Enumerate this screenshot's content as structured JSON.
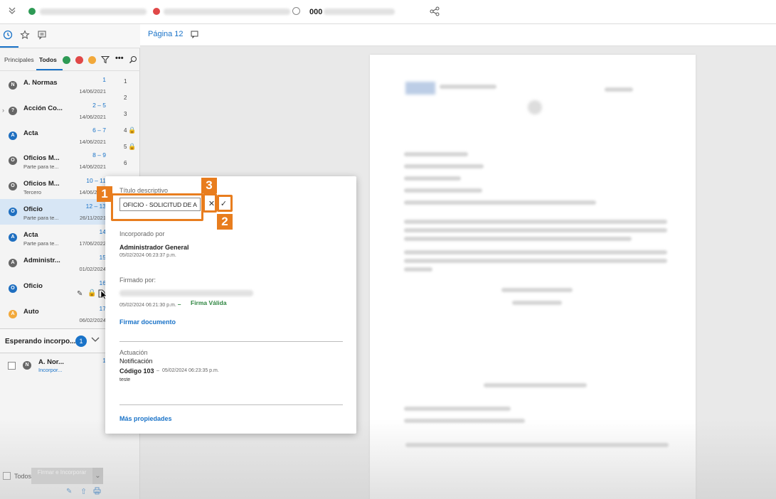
{
  "topbar": {
    "doc_number": "000",
    "icons": [
      "collapse-chevron-icon",
      "add-icon",
      "remove-icon",
      "info-icon",
      "share-icon"
    ]
  },
  "left_panel": {
    "icon_tabs": [
      "clock-icon",
      "star-icon",
      "comment-icon"
    ],
    "filter_tabs": [
      "Principales",
      "Todos"
    ],
    "documents": [
      {
        "title": "A. Normas",
        "subtitle": "",
        "pages": "1",
        "date": "14/06/2021",
        "icon": "N",
        "color": "gray"
      },
      {
        "title": "Acción Co...",
        "subtitle": "",
        "pages": "2 – 5",
        "date": "14/06/2021",
        "icon": "?",
        "color": "gray",
        "expandable": true
      },
      {
        "title": "Acta",
        "subtitle": "",
        "pages": "6 – 7",
        "date": "14/06/2021",
        "icon": "A",
        "color": "blue"
      },
      {
        "title": "Oficios M...",
        "subtitle": "Parte para te...",
        "pages": "8 – 9",
        "date": "14/06/2021",
        "icon": "O",
        "color": "gray"
      },
      {
        "title": "Oficios M...",
        "subtitle": "Tercero",
        "pages": "10 – 11",
        "date": "14/06/2021",
        "icon": "O",
        "color": "gray"
      },
      {
        "title": "Oficio",
        "subtitle": "Parte para te...",
        "pages": "12 – 13",
        "date": "26/11/2021",
        "icon": "O",
        "color": "blue",
        "selected": true
      },
      {
        "title": "Acta",
        "subtitle": "Parte para te...",
        "pages": "14",
        "date": "17/06/2022",
        "icon": "A",
        "color": "blue"
      },
      {
        "title": "Administr...",
        "subtitle": "",
        "pages": "15",
        "date": "01/02/2024",
        "icon": "A",
        "color": "gray"
      },
      {
        "title": "Oficio",
        "subtitle": "",
        "pages": "16",
        "date": "",
        "icon": "O",
        "color": "blue"
      },
      {
        "title": "Auto",
        "subtitle": "",
        "pages": "17",
        "date": "06/02/2024",
        "icon": "A",
        "color": "orange"
      }
    ],
    "page_numbers": [
      "1",
      "2",
      "3",
      "4",
      "5",
      "6"
    ],
    "waiting": {
      "label": "Esperando incorpo...",
      "count": "1"
    },
    "waiting_items": [
      {
        "title": "A. Nor...",
        "subtitle": "Incorpor...",
        "pages": "1"
      }
    ],
    "footer": {
      "select_all": "Todos",
      "action": "Firmar e Incorporar"
    }
  },
  "content": {
    "page_label": "Página 12"
  },
  "popup": {
    "title_label": "Título descriptivo",
    "title_value": "OFICIO - SOLICITUD DE A",
    "incorporated_label": "Incorporado por",
    "incorporated_by": "Administrador General",
    "incorporated_date": "05/02/2024 06:23:37 p.m.",
    "signed_label": "Firmado por:",
    "signed_date": "05/02/2024 06:21:30 p.m.",
    "signature_status": "Firma Válida",
    "sign_link": "Firmar documento",
    "actuacion_label": "Actuación",
    "actuacion_type": "Notificación",
    "actuacion_code": "Código 103",
    "actuacion_date": "05/02/2024 06:23:35 p.m.",
    "actuacion_note": "teste",
    "more_link": "Más propiedades",
    "cancel_symbol": "✕",
    "confirm_symbol": "✓"
  },
  "callouts": [
    "1",
    "2",
    "3"
  ],
  "colors": {
    "accent": "#1a73c8",
    "callout": "#e87d1e",
    "valid": "#2e8540",
    "selected_row": "#d7e6f5"
  }
}
